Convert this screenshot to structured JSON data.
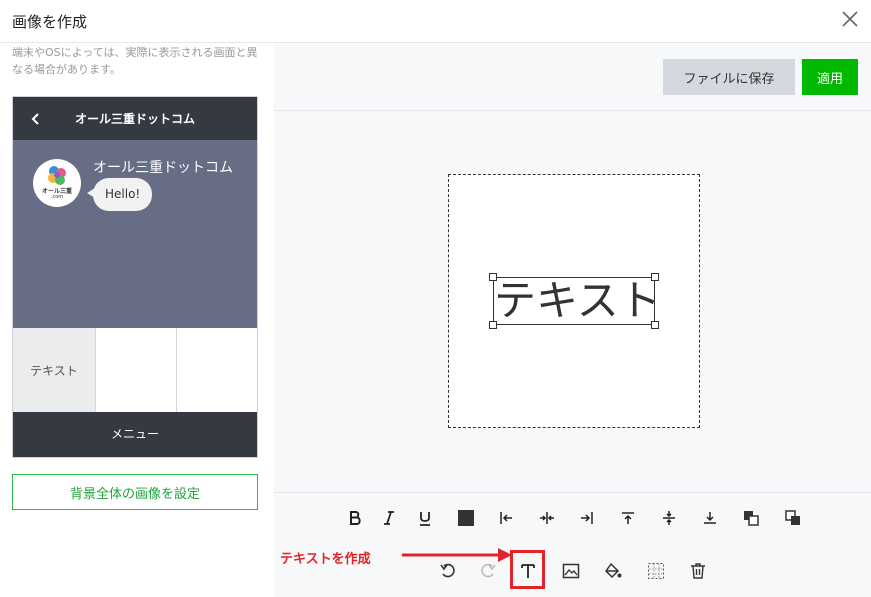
{
  "dialog": {
    "title": "画像を作成"
  },
  "preview": {
    "note": "端末やOSによっては、実際に表示される画面と異なる場合があります。",
    "header_title": "オール三重ドットコム",
    "sender": "オール三重ドットコム",
    "avatar_text_1": "オール三重",
    "avatar_text_2": ".com",
    "message": "Hello!",
    "rich_cells": [
      "テキスト",
      "",
      ""
    ],
    "menu_label": "メニュー",
    "bg_button": "背景全体の画像を設定"
  },
  "editor": {
    "save_button": "ファイルに保存",
    "apply_button": "適用",
    "canvas_text": "テキスト"
  },
  "annotation": {
    "label": "テキストを作成"
  },
  "colors": {
    "accent_green": "#00b900",
    "header_dark": "#353a42",
    "chat_bg": "#666d85",
    "annotation_red": "#e0242a"
  },
  "icons": {
    "format_tools": [
      "bold-icon",
      "italic-icon",
      "underline-icon",
      "color-square-icon",
      "align-left-icon",
      "align-center-icon",
      "align-right-icon",
      "align-top-icon",
      "align-middle-icon",
      "align-bottom-icon",
      "bring-front-icon",
      "send-back-icon"
    ],
    "edit_tools": [
      "undo-icon",
      "redo-icon",
      "text-icon",
      "image-icon",
      "fill-icon",
      "grid-icon",
      "trash-icon"
    ]
  }
}
